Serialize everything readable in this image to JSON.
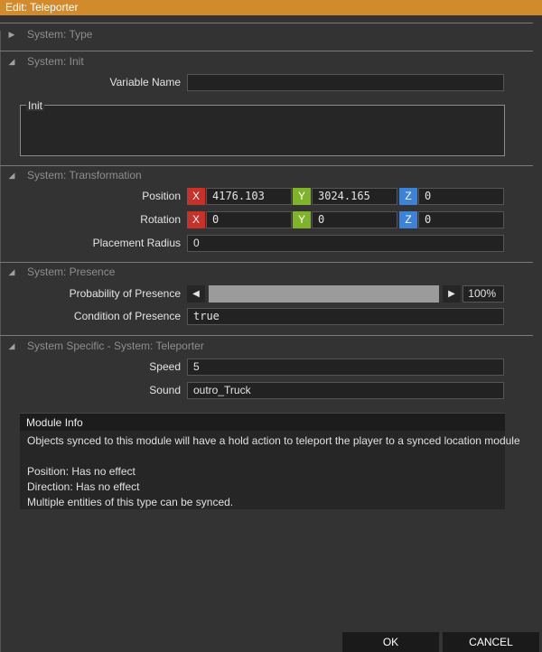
{
  "window": {
    "title": "Edit: Teleporter"
  },
  "sections": {
    "type": {
      "title": "System: Type"
    },
    "init": {
      "title": "System: Init",
      "variable_name_label": "Variable Name",
      "variable_name_value": "",
      "init_label": "Init",
      "init_value": ""
    },
    "transformation": {
      "title": "System: Transformation",
      "position_label": "Position",
      "position": {
        "x": "4176.103",
        "y": "3024.165",
        "z": "0"
      },
      "rotation_label": "Rotation",
      "rotation": {
        "x": "0",
        "y": "0",
        "z": "0"
      },
      "axis_x": "X",
      "axis_y": "Y",
      "axis_z": "Z",
      "placement_radius_label": "Placement Radius",
      "placement_radius_value": "0"
    },
    "presence": {
      "title": "System: Presence",
      "probability_label": "Probability of Presence",
      "probability_value": "100%",
      "probability_fraction": 1.0,
      "condition_label": "Condition of Presence",
      "condition_value": "true"
    },
    "specific": {
      "title": "System Specific - System: Teleporter",
      "speed_label": "Speed",
      "speed_value": "5",
      "sound_label": "Sound",
      "sound_value": "outro_Truck"
    }
  },
  "module_info": {
    "title": "Module Info",
    "lines": [
      "Objects synced to this module will have a hold action to teleport the player to a synced location module",
      "Position: Has no effect",
      "Direction: Has no effect",
      "Multiple entities of this type can be synced."
    ]
  },
  "buttons": {
    "ok": "OK",
    "cancel": "CANCEL"
  },
  "colors": {
    "title_bar": "#d18a2c",
    "axis_x": "#c8302a",
    "axis_y": "#7fb42a",
    "axis_z": "#3c82d8"
  }
}
